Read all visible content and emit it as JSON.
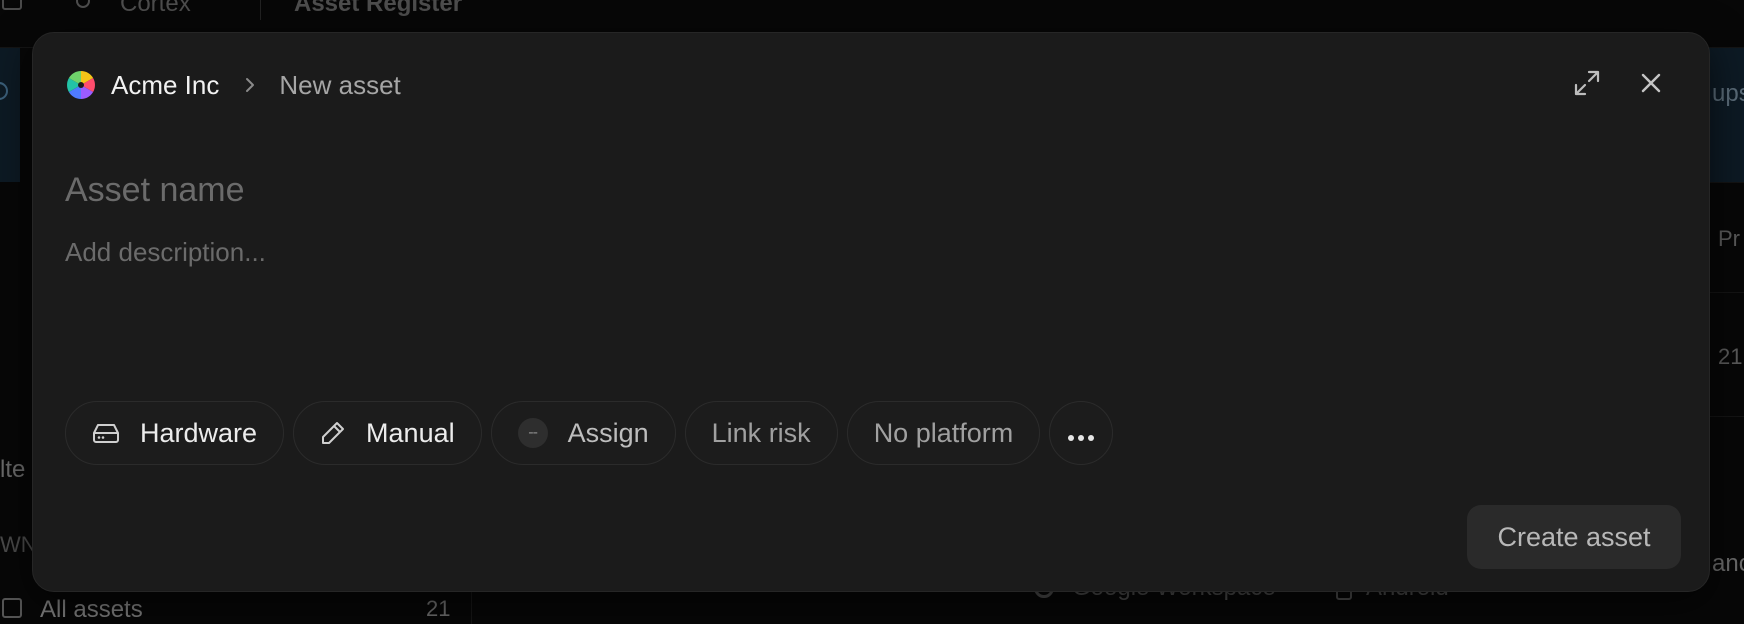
{
  "background": {
    "topbar": {
      "app_name": "Cortex",
      "section": "Asset Register"
    },
    "sidebar": {
      "filter_partial": "lte",
      "group_partial": "WN",
      "all_assets_label": "All assets",
      "all_assets_count": "21"
    },
    "right_column": {
      "header_partial": "ups",
      "col_partial": "Pr",
      "count_partial": "21",
      "row_partial": "anc"
    },
    "row": {
      "integration": "Google Workspace",
      "platform": "Android"
    }
  },
  "modal": {
    "breadcrumb": {
      "workspace": "Acme Inc",
      "current": "New asset"
    },
    "asset_name_placeholder": "Asset name",
    "description_placeholder": "Add description...",
    "chips": {
      "type": "Hardware",
      "source": "Manual",
      "assignee_avatar": "--",
      "assign": "Assign",
      "link_risk": "Link risk",
      "platform": "No platform"
    },
    "create_label": "Create asset"
  },
  "colors": {
    "modal_bg": "#1b1b1b",
    "page_bg": "#070707",
    "logo": [
      "#f5c518",
      "#ff4d6d",
      "#4f7bff",
      "#22c3a6",
      "#9b5cff",
      "#ff8a3d"
    ]
  }
}
